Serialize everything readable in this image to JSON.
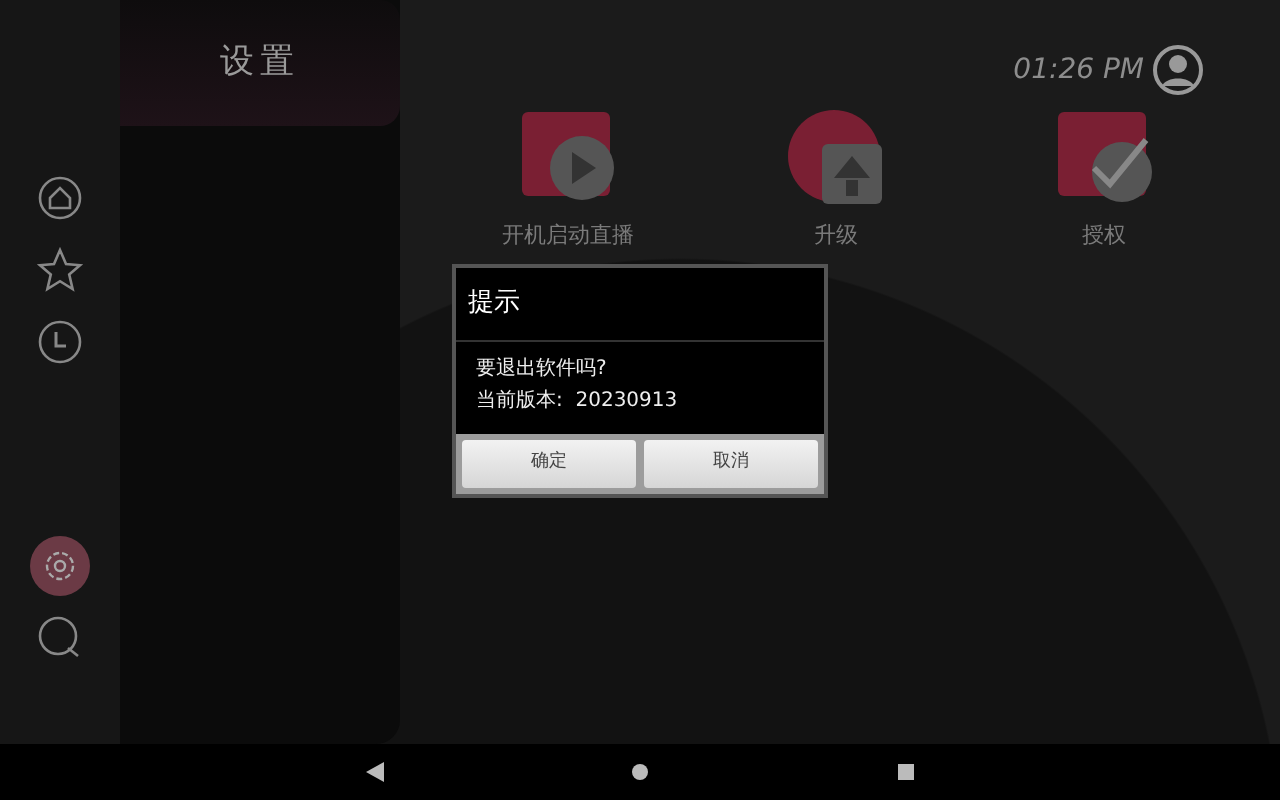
{
  "panel": {
    "title": "设置"
  },
  "sidebar": {
    "items": [
      {
        "kind": "home",
        "selected": false
      },
      {
        "kind": "star",
        "selected": false
      },
      {
        "kind": "history",
        "selected": false
      },
      {
        "kind": "settings",
        "selected": true
      },
      {
        "kind": "search",
        "selected": false
      }
    ]
  },
  "status": {
    "time": "01:26 PM"
  },
  "tiles": [
    {
      "kind": "play",
      "label": "开机启动直播"
    },
    {
      "kind": "upgrade",
      "label": "升级"
    },
    {
      "kind": "authorize",
      "label": "授权"
    }
  ],
  "dialog": {
    "title": "提示",
    "lines": [
      "要退出软件吗?",
      "当前版本:  20230913"
    ],
    "buttons": [
      "确定",
      "取消"
    ]
  },
  "nav_bar": {
    "buttons": [
      {
        "kind": "back"
      },
      {
        "kind": "home"
      },
      {
        "kind": "recents"
      }
    ]
  }
}
